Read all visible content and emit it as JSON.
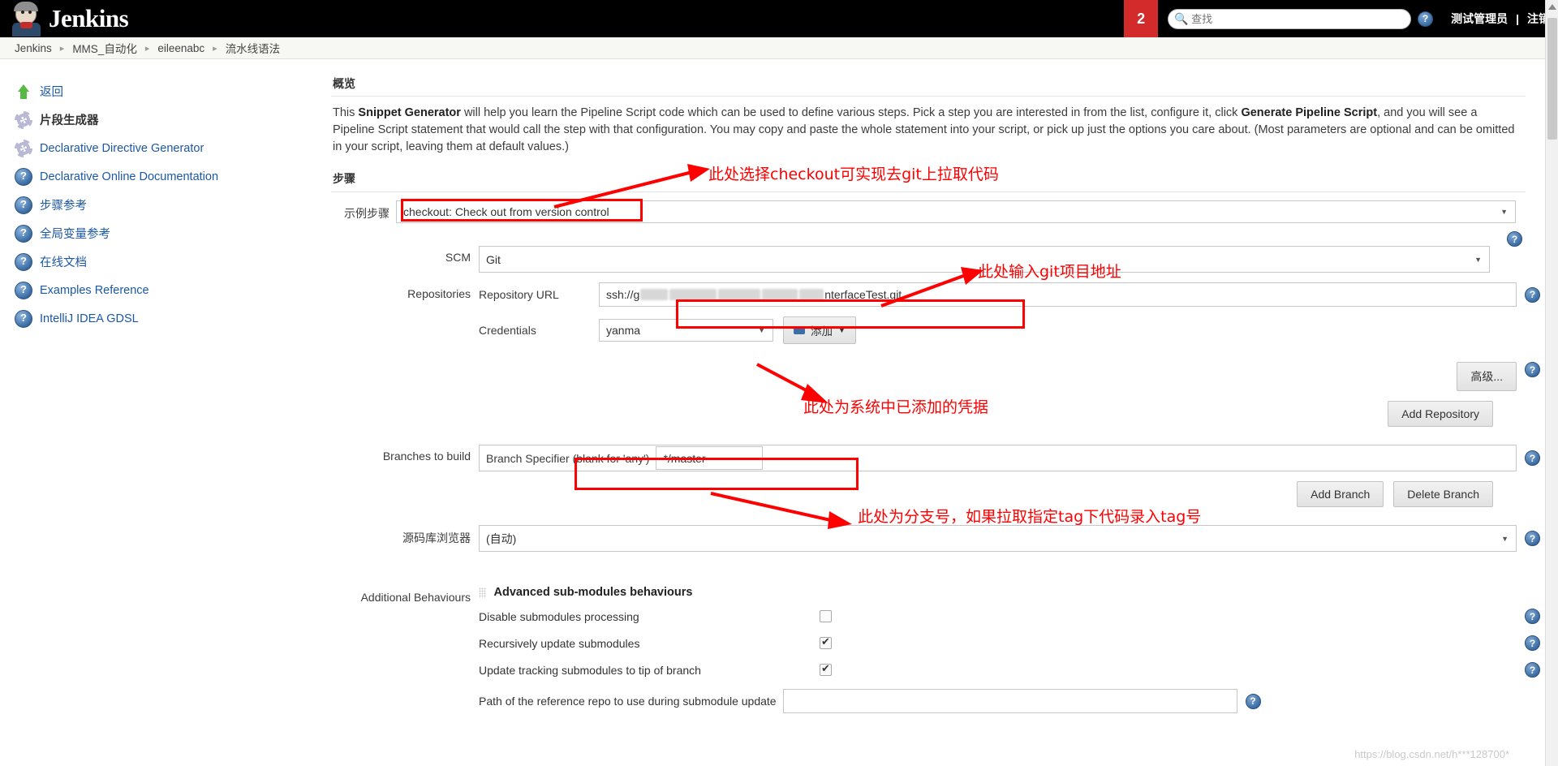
{
  "header": {
    "brand": "Jenkins",
    "notification_count": "2",
    "search_placeholder": "查找",
    "user_name": "测试管理员",
    "logout_label": "注销",
    "separator": "|"
  },
  "breadcrumb": {
    "items": [
      "Jenkins",
      "MMS_自动化",
      "eileenabc",
      "流水线语法"
    ],
    "separator": "▸"
  },
  "sidebar": {
    "items": [
      {
        "label": "返回",
        "icon": "up-arrow-icon",
        "bold": false
      },
      {
        "label": "片段生成器",
        "icon": "gear-icon",
        "bold": true
      },
      {
        "label": "Declarative Directive Generator",
        "icon": "gear-icon",
        "bold": false
      },
      {
        "label": "Declarative Online Documentation",
        "icon": "help-icon",
        "bold": false
      },
      {
        "label": "步骤参考",
        "icon": "help-icon",
        "bold": false
      },
      {
        "label": "全局变量参考",
        "icon": "help-icon",
        "bold": false
      },
      {
        "label": "在线文档",
        "icon": "help-icon",
        "bold": false
      },
      {
        "label": "Examples Reference",
        "icon": "help-icon",
        "bold": false
      },
      {
        "label": "IntelliJ IDEA GDSL",
        "icon": "help-icon",
        "bold": false
      }
    ]
  },
  "main": {
    "overview_title": "概览",
    "intro_part1": "This ",
    "intro_bold1": "Snippet Generator",
    "intro_part2": " will help you learn the Pipeline Script code which can be used to define various steps. Pick a step you are interested in from the list, configure it, click ",
    "intro_bold2": "Generate Pipeline Script",
    "intro_part3": ", and you will see a Pipeline Script statement that would call the step with that configuration. You may copy and paste the whole statement into your script, or pick up just the options you care about. (Most parameters are optional and can be omitted in your script, leaving them at default values.)",
    "steps_title": "步骤",
    "sample_step_label": "示例步骤",
    "sample_step_value": "checkout: Check out from version control",
    "scm_label": "SCM",
    "scm_value": "Git",
    "repositories_label": "Repositories",
    "repository_url_label": "Repository URL",
    "repository_url_prefix": "ssh://g",
    "repository_url_suffix": "nterfaceTest.git",
    "credentials_label": "Credentials",
    "credentials_value": "yanma",
    "add_credentials_label": "添加",
    "advanced_label": "高级...",
    "add_repository_label": "Add Repository",
    "branches_label": "Branches to build",
    "branch_specifier_label": "Branch Specifier (blank for 'any')",
    "branch_specifier_value": "*/master",
    "add_branch_label": "Add Branch",
    "delete_branch_label": "Delete Branch",
    "repo_browser_label": "源码库浏览器",
    "repo_browser_value": "(自动)",
    "additional_behaviours_label": "Additional Behaviours",
    "advanced_submodules_title": "Advanced sub-modules behaviours",
    "submodule_rows": [
      {
        "label": "Disable submodules processing",
        "checked": false
      },
      {
        "label": "Recursively update submodules",
        "checked": true
      },
      {
        "label": "Update tracking submodules to tip of branch",
        "checked": true
      }
    ],
    "reference_repo_label": "Path of the reference repo to use during submodule update",
    "reference_repo_value": ""
  },
  "annotations": [
    {
      "id": "annot-checkout",
      "text": "此处选择checkout可实现去git上拉取代码"
    },
    {
      "id": "annot-git-url",
      "text": "此处输入git项目地址"
    },
    {
      "id": "annot-credentials",
      "text": "此处为系统中已添加的凭据"
    },
    {
      "id": "annot-branch",
      "text": "此处为分支号，如果拉取指定tag下代码录入tag号"
    }
  ],
  "watermark": "https://blog.csdn.net/h***128700*",
  "colors": {
    "accent_red": "#ff0000",
    "badge_red": "#d32b2b",
    "link_blue": "#1b57a5",
    "topbar_black": "#000000"
  }
}
